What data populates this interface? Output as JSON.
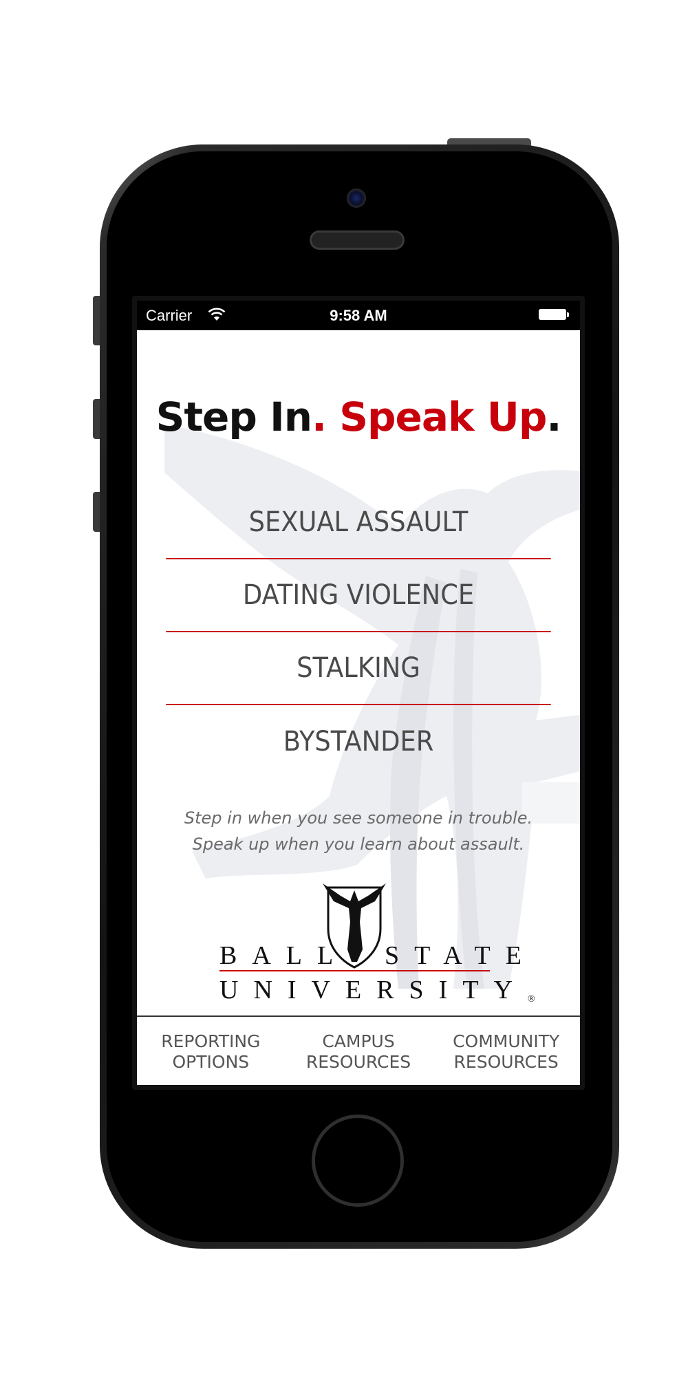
{
  "status_bar": {
    "carrier": "Carrier",
    "time": "9:58 AM"
  },
  "title": {
    "part1": "Step In",
    "dot1": ".",
    "part2": " Speak Up",
    "dot2": "."
  },
  "menu": {
    "items": [
      {
        "label": "SEXUAL ASSAULT"
      },
      {
        "label": "DATING VIOLENCE"
      },
      {
        "label": "STALKING"
      },
      {
        "label": "BYSTANDER"
      }
    ]
  },
  "tagline": {
    "line1": "Step in when you see someone in trouble.",
    "line2": "Speak up when you learn about assault."
  },
  "logo": {
    "line1_left": "BALL",
    "line1_right": "STATE",
    "line2": "UNIVERSITY",
    "mark": "®"
  },
  "tabbar": {
    "tabs": [
      {
        "label": "REPORTING\nOPTIONS"
      },
      {
        "label": "CAMPUS\nRESOURCES"
      },
      {
        "label": "COMMUNITY\nRESOURCES"
      }
    ]
  },
  "colors": {
    "brand_red": "#c8000b",
    "text_gray": "#4a4a4a"
  },
  "icons": [
    "wifi-icon",
    "battery-icon",
    "cardinal-watermark",
    "beneficence-statue-icon"
  ]
}
